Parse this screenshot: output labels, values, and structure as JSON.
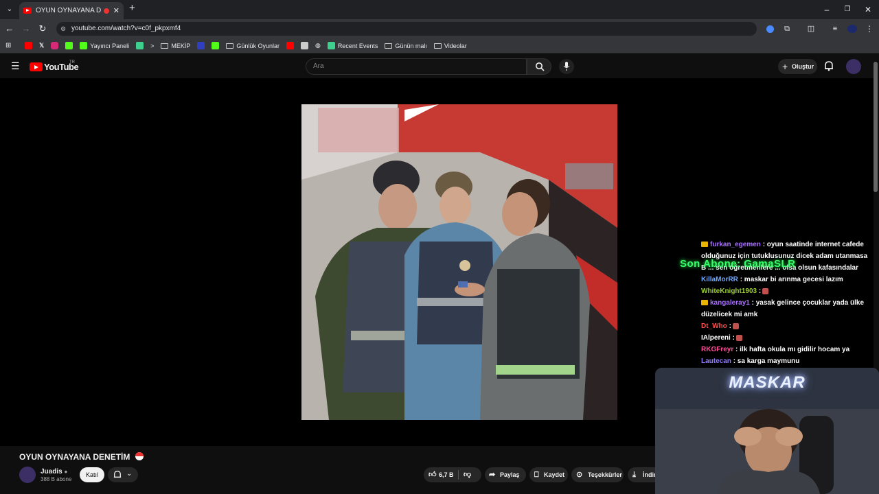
{
  "browser": {
    "tab_title": "OYUN OYNAYANA DENETİM",
    "url": "youtube.com/watch?v=c0f_pkpxmf4",
    "bookmarks": [
      "Yayıncı Paneli",
      "MEKİP",
      "Günlük Oyunlar",
      "Recent Events",
      "Günün malı",
      "Videolar"
    ]
  },
  "youtube": {
    "logo_text": "YouTube",
    "region": "TR",
    "search_placeholder": "Ara",
    "create_label": "Oluştur"
  },
  "chat": [
    {
      "user": "furkan_egemen",
      "color": "#a970ff",
      "badge": true,
      "text": ": oyun saatinde internet cafede olduğunuz için tutuklusunuz dicek adam utanmasa"
    },
    {
      "user": "B",
      "color": "#ffffff",
      "badge": false,
      "text": "... sen öğretmenlere ... olsa olsun kafasındalar"
    },
    {
      "user": "KillaMorRR",
      "color": "#6fa8ff",
      "badge": false,
      "text": ": maskar bi arınma gecesi lazım"
    },
    {
      "user": "WhiteKnight1903",
      "color": "#9acd32",
      "badge": false,
      "text": ":",
      "emote": true
    },
    {
      "user": "kangaleray1",
      "color": "#a970ff",
      "badge": true,
      "text": ": yasak gelince çocuklar yada ülke düzelicek mi amk"
    },
    {
      "user": "Dt_Who",
      "color": "#ff4d4d",
      "badge": false,
      "text": ":",
      "emote": true
    },
    {
      "user": "IAlpereni",
      "color": "#ffffff",
      "badge": false,
      "text": ":",
      "emote": true
    },
    {
      "user": "RKGFreyr",
      "color": "#ff4f9a",
      "badge": false,
      "text": ": ilk hafta okula mı gidilir hocam ya"
    },
    {
      "user": "Lautecan",
      "color": "#8f7bff",
      "badge": false,
      "text": ": sa karga maymunu"
    }
  ],
  "overlay": {
    "sub_alert": "Son Abone: GamaSLR",
    "neon_sign": "MASKAR"
  },
  "video": {
    "title": "OYUN OYNAYANA DENETİM",
    "channel": "Juadis",
    "subscribers": "388 B abone",
    "join_label": "Katıl",
    "likes": "6,7 B",
    "share_label": "Paylaş",
    "save_label": "Kaydet",
    "thanks_label": "Teşekkürler",
    "download_label": "İndir"
  }
}
